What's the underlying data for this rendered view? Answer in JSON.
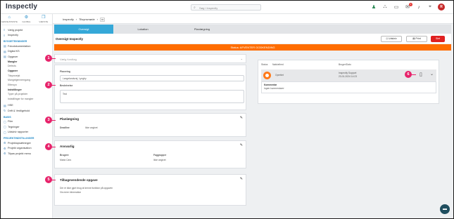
{
  "app": {
    "logo": "Inspectly"
  },
  "search": {
    "placeholder": "Søg i Inspectly",
    "icon": "search-icon"
  },
  "topbar_icons": [
    "person-icon",
    "network-icon",
    "chat-icon",
    "notification-icon",
    "bell-icon",
    "pin-icon"
  ],
  "notification_count": "1",
  "user": {
    "initial": "R"
  },
  "sidebar": {
    "tabs": [
      {
        "icon": "home-icon",
        "label": "GENVEJSTASTE"
      },
      {
        "icon": "gear-icon",
        "label": "GLOBAL"
      },
      {
        "icon": "cube-icon",
        "label": "VÆKSTE"
      }
    ],
    "top_items": [
      {
        "icon": "list-icon",
        "label": "Vælg projekt"
      },
      {
        "icon": "list-icon",
        "label": "Inspectly"
      }
    ],
    "section1": "BYGGETEKNINGER",
    "items1": [
      {
        "icon": "doc-icon",
        "label": "Fotodokumentation"
      },
      {
        "icon": "doc-icon",
        "label": "Digital KS"
      },
      {
        "icon": "doc-icon",
        "label": "Opgaver"
      }
    ],
    "sub1": [
      {
        "label": "Mangler",
        "bold": true
      },
      {
        "label": "Defects",
        "bold": false
      },
      {
        "label": "Opgaver",
        "bold": true
      },
      {
        "label": "Tilsynsrejst",
        "bold": false
      },
      {
        "label": "Mangelgennemgang",
        "bold": false
      },
      {
        "label": "Eftersyn",
        "bold": false
      },
      {
        "label": "Indstillinger",
        "bold": true
      },
      {
        "label": "Typer på projekter",
        "bold": false
      },
      {
        "label": "Indstillinger for mangler",
        "bold": false
      }
    ],
    "items2": [
      {
        "icon": "doc-icon",
        "label": "HSE"
      },
      {
        "icon": "refresh-icon",
        "label": "Drift & Vedligehold"
      }
    ],
    "section2": "BASIS",
    "items3": [
      {
        "icon": "file-icon",
        "label": "Filer"
      },
      {
        "icon": "file-icon",
        "label": "Tegninger"
      },
      {
        "icon": "file-icon",
        "label": "Udskriv rapporter"
      }
    ],
    "section3": "PROJEKTINDSTILLINGER",
    "items4": [
      {
        "icon": "gear-icon",
        "label": "Projektopsætninger"
      },
      {
        "icon": "gear-icon",
        "label": "Projekt organisation"
      },
      {
        "icon": "gear-icon",
        "label": "Tilpas projekt menu"
      }
    ]
  },
  "breadcrumb": {
    "items": [
      "Inspectly",
      "Tilsynsmøde"
    ],
    "chip": "#1"
  },
  "tabs": [
    "Oversigt",
    "Lokation",
    "Planlægning"
  ],
  "title": "Oversigt Inspectly",
  "buttons": {
    "export": "Udskriv",
    "print": "Print",
    "delete": "Slet"
  },
  "status_banner": "Status: AFVENTER GODKENDING",
  "cards": {
    "select_placeholder": "Vælg fundtag",
    "placement_label": "Placering",
    "placement_value": "Langelandsvej, Lyngby",
    "description_label": "Beskrivelse",
    "description_value": "Test",
    "planning": {
      "title": "Planlægning",
      "deadline_label": "Deadline",
      "deadline_value": "Ikke angivet"
    },
    "responsible": {
      "title": "Ansvarlig",
      "col1_label": "Brugere",
      "col1_value": "Maria Cars",
      "col2_label": "Faggrupper",
      "col2_value": "Ikke angivet"
    },
    "recurring": {
      "title": "Tilbagevendende opgave",
      "line1": "Der er ikke gjort brug af denne funktion på opgaven",
      "line2": "Vis mere information"
    }
  },
  "right_panel": {
    "headers": [
      "Status",
      "Nøkkelhed",
      "Bruger/Dato"
    ],
    "row": {
      "status": "Oprettet",
      "user": "Inspectly Support",
      "date": "23-01-2024 14:23"
    },
    "comment_label": "Kommentar",
    "comment_value": "Ingen kommentarer"
  },
  "markers": [
    "1",
    "2",
    "3",
    "4",
    "5",
    "6"
  ]
}
